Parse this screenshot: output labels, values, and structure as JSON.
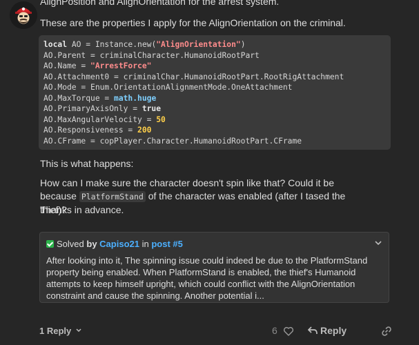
{
  "post": {
    "top_line": "AlignPosition and AlignOrientation for the arrest system.",
    "intro": "These are the properties I apply for the AlignOrientation on the criminal.",
    "code_lines": [
      [
        {
          "t": "local",
          "c": "kw"
        },
        {
          "t": " AO = Instance.new(",
          "c": ""
        },
        {
          "t": "\"AlignOrientation\"",
          "c": "str"
        },
        {
          "t": ")",
          "c": ""
        }
      ],
      [
        {
          "t": "AO.Parent = criminalCharacter.HumanoidRootPart",
          "c": ""
        }
      ],
      [
        {
          "t": "AO.Name = ",
          "c": ""
        },
        {
          "t": "\"ArrestForce\"",
          "c": "str"
        }
      ],
      [
        {
          "t": "AO.Attachment0 = criminalChar.HumanoidRootPart.RootRigAttachment",
          "c": ""
        }
      ],
      [
        {
          "t": "AO.Mode = Enum.OrientationAlignmentMode.OneAttachment",
          "c": ""
        }
      ],
      [
        {
          "t": "AO.MaxTorque = ",
          "c": ""
        },
        {
          "t": "math.huge",
          "c": "lib"
        }
      ],
      [
        {
          "t": "AO.PrimaryAxisOnly = ",
          "c": ""
        },
        {
          "t": "true",
          "c": "kw"
        }
      ],
      [
        {
          "t": "AO.MaxAngularVelocity = ",
          "c": ""
        },
        {
          "t": "50",
          "c": "num"
        }
      ],
      [
        {
          "t": "AO.Responsiveness = ",
          "c": ""
        },
        {
          "t": "200",
          "c": "num"
        }
      ],
      [
        {
          "t": "AO.CFrame = copPlayer.Character.HumanoidRootPart.CFrame",
          "c": ""
        }
      ]
    ],
    "what_happens": "This is what happens:",
    "question_a": "How can I make sure the character doesn't spin like that? Could it be because",
    "question_code": "PlatformStand",
    "question_b": "of the character was enabled (after I tased the thief)?",
    "thanks": "Thanks in advance."
  },
  "solved": {
    "label": "Solved",
    "by": "by",
    "author": "Capiso21",
    "in": "in",
    "post_ref": "post #5",
    "excerpt": "After looking into it, The spinning issue could indeed be due to the PlatformStand property being enabled. When PlatformStand is enabled, the thief's Humanoid attempts to keep himself upright, which could conflict with the AlignOrientation constraint and cause the spinning. Another potential i..."
  },
  "actions": {
    "replies": "1 Reply",
    "like_count": "6",
    "reply_label": "Reply"
  },
  "colors": {
    "background": "#262626",
    "code_bg": "#3a3a3a",
    "link": "#4cb0ff",
    "solved_check": "#2bb34a"
  }
}
